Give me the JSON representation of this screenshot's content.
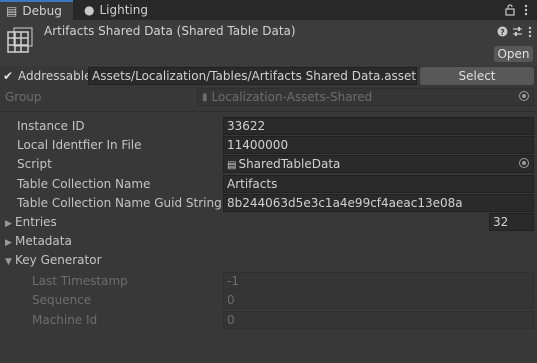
{
  "tabs": [
    {
      "label": "Debug",
      "icon": "inspector-icon",
      "active": true
    },
    {
      "label": "Lighting",
      "icon": "lightbulb-icon",
      "active": false
    }
  ],
  "window_icons": [
    "lock-icon",
    "kebab-menu-icon"
  ],
  "header": {
    "title": "Artifacts Shared Data (Shared Table Data)",
    "open_label": "Open",
    "icons": [
      "help-icon",
      "presets-icon",
      "kebab-menu-icon"
    ]
  },
  "addressable": {
    "label": "Addressable",
    "checked": true,
    "path": "Assets/Localization/Tables/Artifacts Shared Data.asset",
    "select_label": "Select"
  },
  "group": {
    "label": "Group",
    "value": "Localization-Assets-Shared"
  },
  "properties": [
    {
      "label": "Instance ID",
      "value": "33622"
    },
    {
      "label": "Local Identfier In File",
      "value": "11400000"
    },
    {
      "label": "Script",
      "value": "SharedTableData"
    },
    {
      "label": "Table Collection Name",
      "value": "Artifacts"
    },
    {
      "label": "Table Collection Name Guid String",
      "value": "8b244063d5e3c1a4e99cf4aeac13e08a"
    }
  ],
  "entries": {
    "label": "Entries",
    "count": "32",
    "expanded": false
  },
  "metadata": {
    "label": "Metadata",
    "expanded": false
  },
  "key_generator": {
    "label": "Key Generator",
    "expanded": true,
    "fields": [
      {
        "label": "Last Timestamp",
        "value": "-1"
      },
      {
        "label": "Sequence",
        "value": "0"
      },
      {
        "label": "Machine Id",
        "value": "0"
      }
    ]
  },
  "colors": {
    "accent": "#3a79bb",
    "background": "#383838",
    "field": "#2a2a2a"
  }
}
